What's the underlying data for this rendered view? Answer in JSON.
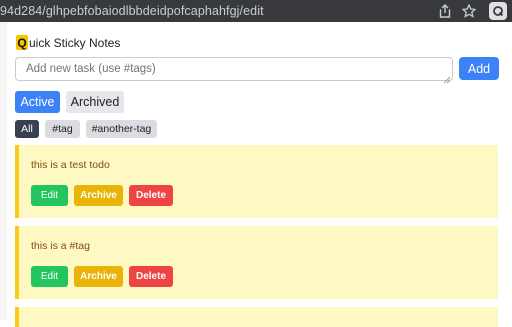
{
  "browser": {
    "url": "94d284/glhpebfobaiodlbbdeidpofcaphahfgj/edit",
    "share_icon": "share-icon",
    "star_icon": "star-icon",
    "extension_icon": "extension-q-icon"
  },
  "app": {
    "logo_letter": "Q",
    "title_rest": "uick Sticky Notes"
  },
  "input": {
    "placeholder": "Add new task (use #tags)",
    "value": ""
  },
  "add_button": "Add",
  "tabs": [
    {
      "label": "Active",
      "selected": true
    },
    {
      "label": "Archived",
      "selected": false
    }
  ],
  "tags": [
    {
      "label": "All",
      "selected": true
    },
    {
      "label": "#tag",
      "selected": false
    },
    {
      "label": "#another-tag",
      "selected": false
    }
  ],
  "todos": [
    {
      "text": "this is a test todo"
    },
    {
      "text": "this is a #tag"
    }
  ],
  "actions": {
    "edit": "Edit",
    "archive": "Archive",
    "delete": "Delete"
  },
  "colors": {
    "primary": "#3b82f6",
    "edit": "#22c55e",
    "archive": "#eab308",
    "delete": "#ef4444",
    "card_bg": "#fef9c3",
    "card_border": "#facc15",
    "logo": "#f5c400"
  }
}
